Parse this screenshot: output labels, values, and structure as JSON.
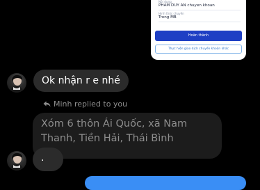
{
  "receipt": {
    "content_label": "Nội dung",
    "content_value": "PHAM DUY AN chuyen khoan",
    "type_label": "Hình thức chuyển",
    "type_value": "Trong MB",
    "done_button": "Hoàn thành",
    "new_transfer_button": "Thực hiện giao dịch chuyển khoản khác"
  },
  "messages": [
    {
      "text": "Ok nhận r e nhé"
    },
    {
      "text": "."
    }
  ],
  "reply": {
    "meta": "Minh replied to you",
    "quoted_text": "Xóm 6 thôn Ái Quốc, xã Nam Thanh, Tiền Hải, Thái Bình"
  },
  "colors": {
    "background": "#000000",
    "incoming_bubble": "#2b2b2b",
    "quoted_bubble": "#1c1c1c",
    "outgoing_bubble": "#3a8ef5",
    "primary_button": "#1e3fc4"
  }
}
